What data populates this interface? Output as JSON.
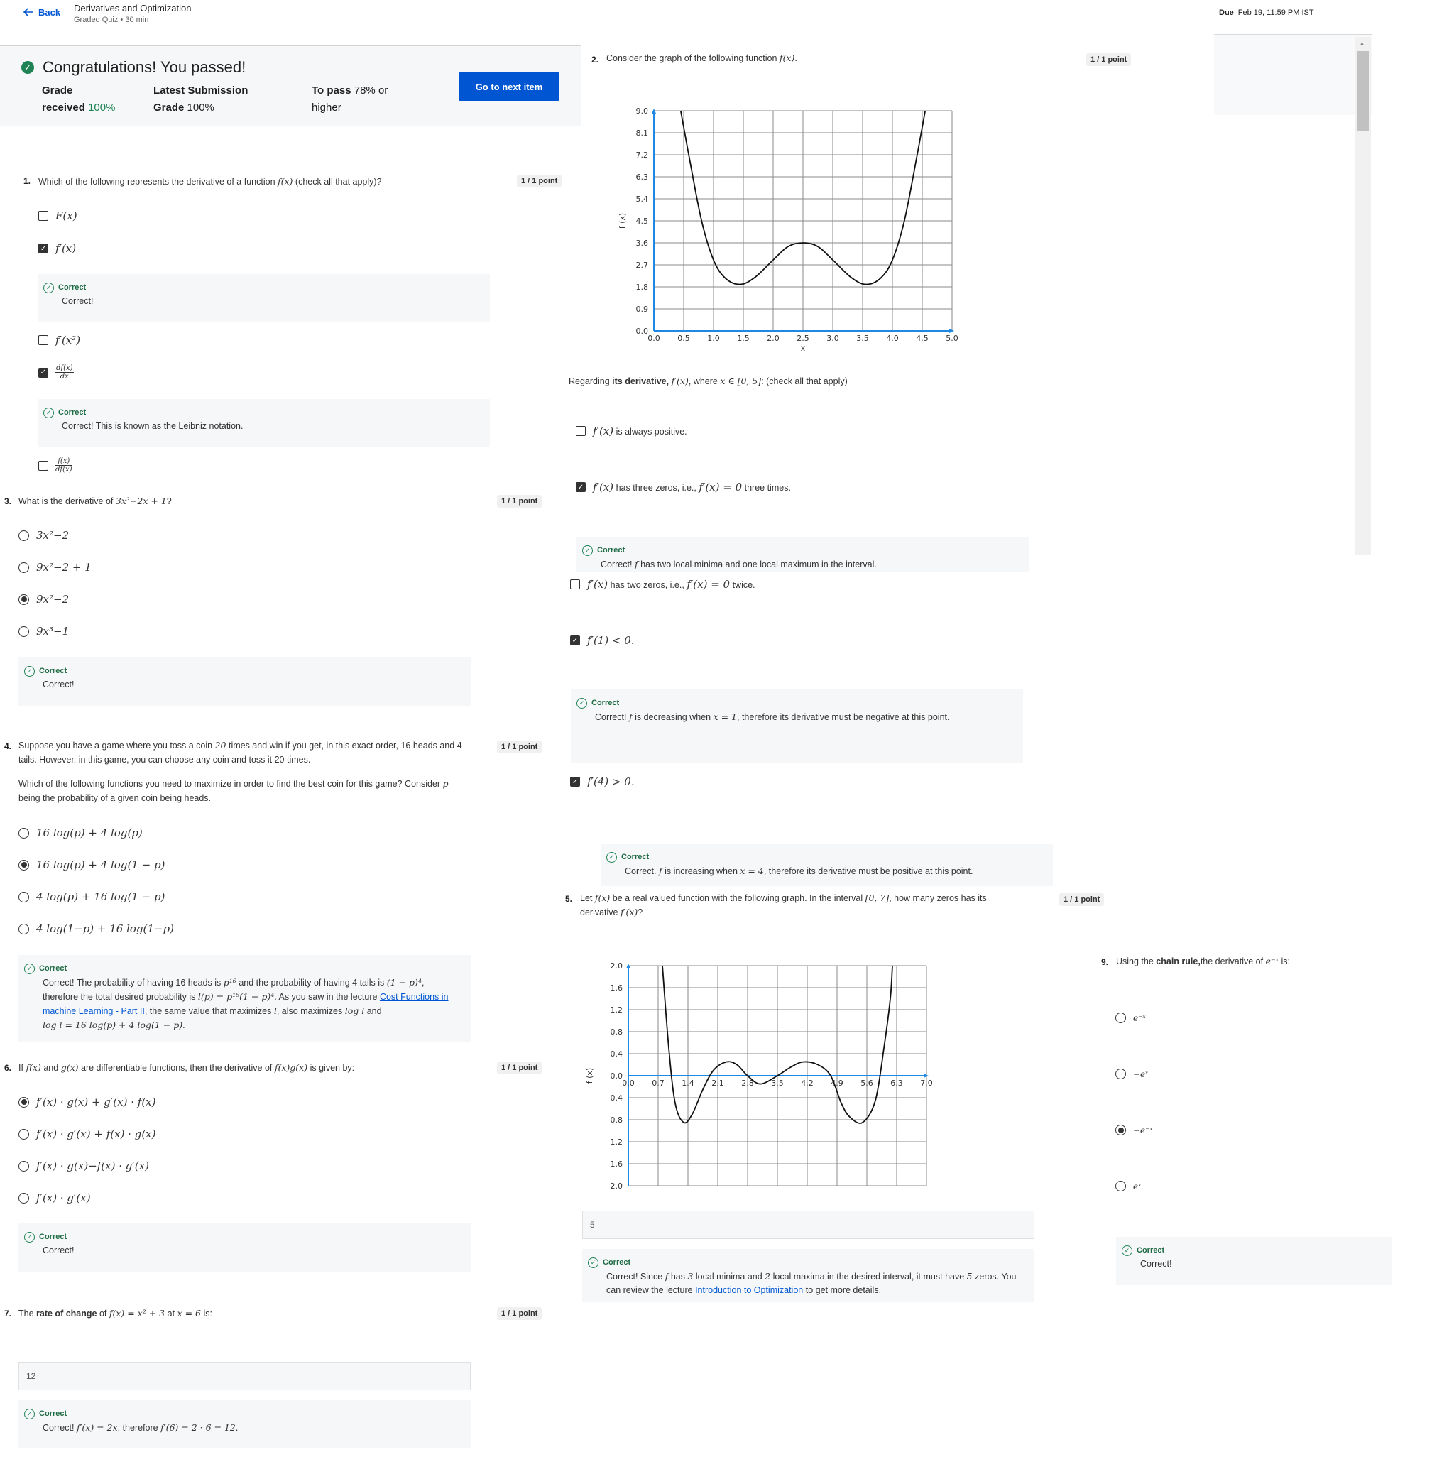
{
  "header": {
    "back": "Back",
    "title": "Derivatives and Optimization",
    "subtitle": "Graded Quiz • 30 min",
    "due_label": "Due",
    "due_value": "Feb 19, 11:59 PM IST"
  },
  "banner": {
    "title": "Congratulations! You passed!",
    "grade_label_1": "Grade",
    "grade_label_2": "received",
    "grade_value": "100%",
    "latest_label_1": "Latest Submission",
    "latest_label_2": "Grade",
    "latest_value": "100%",
    "pass_label": "To pass",
    "pass_value_1": "78% or",
    "pass_value_2": "higher",
    "next_button": "Go to next item"
  },
  "points": "1 / 1 point",
  "correct": "Correct",
  "q1": {
    "num": "1.",
    "text_pre": "Which of the following represents the derivative of a function",
    "text_post": "(check all that apply)?",
    "fb1": "Correct!",
    "fb2": "Correct! This is known as the Leibniz notation."
  },
  "q2": {
    "num": "2.",
    "text": "Consider the graph of the following function",
    "regarding_pre": "Regarding",
    "regarding_bold": "its derivative,",
    "regarding_mid": "where",
    "regarding_post": ": (check all that apply)",
    "o1": "is always positive.",
    "o2": "has three zeros, i.e.,",
    "o2b": "three times.",
    "o3": "has two zeros, i.e.,",
    "o3b": "twice.",
    "fb1_pre": "Correct!",
    "fb1_post": "has two local minima and one local maximum in the interval.",
    "fb2_pre": "Correct!",
    "fb2_mid": "is decreasing when",
    "fb2_post": ", therefore its derivative must be negative at this point.",
    "fb3_pre": "Correct.",
    "fb3_mid": "is increasing when",
    "fb3_post": ", therefore its derivative must be positive at this point."
  },
  "q3": {
    "num": "3.",
    "text": "What is the derivative of"
  },
  "q4": {
    "num": "4.",
    "text_a": "Suppose you have a game where you toss a coin",
    "text_b": "times and win if you get, in this exact order, 16 heads and 4",
    "text_c": "tails. However, in this game, you can choose any coin and toss it 20 times.",
    "text_d": "Which of the following functions you need to maximize in order to find the best coin for this game? Consider",
    "text_e": "being the probability of a given coin being heads.",
    "fb_a": "Correct! The probability of having 16 heads is",
    "fb_b": "and the probability of having 4 tails is",
    "fb_c": "therefore the total desired probability is",
    "fb_d": ". As you saw in the lecture",
    "fb_link1": "Cost Functions in",
    "fb_link2": "machine Learning - Part II",
    "fb_e": ", the same value that maximizes",
    "fb_f": ", also maximizes",
    "fb_g": "and"
  },
  "q5": {
    "num": "5.",
    "text_a": "Let",
    "text_b": "be a real valued function with the following graph. In the interval",
    "text_c": ", how many zeros has its",
    "text_d": "derivative",
    "answer": "5",
    "fb_a": "Correct! Since",
    "fb_b": "has",
    "fb_c": "local minima and",
    "fb_d": "local maxima in the desired interval, it must have",
    "fb_e": "zeros. You",
    "fb_f": "can review the lecture",
    "fb_link": "Introduction to Optimization",
    "fb_g": "to get more details."
  },
  "q6": {
    "num": "6.",
    "text_a": "If",
    "text_b": "and",
    "text_c": "are differentiable functions, then the derivative of",
    "text_d": "is given by:",
    "fb": "Correct!"
  },
  "q7": {
    "num": "7.",
    "text_pre": "The",
    "text_bold": "rate of change",
    "text_mid": "of",
    "text_post": "at",
    "text_end": "is:",
    "answer": "12",
    "fb_a": "Correct!",
    "fb_b": ", therefore"
  },
  "q9": {
    "num": "9.",
    "text_pre": "Using the",
    "text_bold": "chain rule,",
    "text_post": "the derivative of",
    "text_end": "is:",
    "fb": "Correct!"
  },
  "chart_data": [
    {
      "type": "line",
      "xlabel": "x",
      "ylabel": "f (x)",
      "x_ticks": [
        "0.0",
        "0.5",
        "1.0",
        "1.5",
        "2.0",
        "2.5",
        "3.0",
        "3.5",
        "4.0",
        "4.5",
        "5.0"
      ],
      "y_ticks": [
        "0.0",
        "0.9",
        "1.8",
        "2.7",
        "3.6",
        "4.5",
        "5.4",
        "6.3",
        "7.2",
        "8.1",
        "9.0"
      ],
      "xlim": [
        0,
        5
      ],
      "ylim": [
        0,
        9
      ],
      "grid": true,
      "x": [
        0.45,
        0.6,
        0.8,
        1.0,
        1.2,
        1.45,
        1.7,
        2.0,
        2.25,
        2.5,
        2.75,
        3.0,
        3.3,
        3.55,
        3.8,
        4.0,
        4.2,
        4.4,
        4.55
      ],
      "y": [
        9.0,
        7.0,
        4.5,
        2.9,
        2.15,
        1.9,
        2.2,
        2.9,
        3.45,
        3.6,
        3.45,
        2.9,
        2.2,
        1.9,
        2.15,
        2.9,
        4.5,
        7.0,
        9.0
      ]
    },
    {
      "type": "line",
      "ylabel": "f (x)",
      "x_ticks": [
        "0.0",
        "0.7",
        "1.4",
        "2.1",
        "2.8",
        "3.5",
        "4.2",
        "4.9",
        "5.6",
        "6.3",
        "7.0"
      ],
      "y_ticks": [
        "2.0",
        "1.6",
        "1.2",
        "0.8",
        "0.4",
        "0.0",
        "−0.4",
        "−0.8",
        "−1.2",
        "−1.6",
        "−2.0"
      ],
      "xlim": [
        0,
        7
      ],
      "ylim": [
        -2,
        2
      ],
      "grid": true,
      "x": [
        0.8,
        0.95,
        1.1,
        1.3,
        1.5,
        1.75,
        2.0,
        2.3,
        2.55,
        2.8,
        3.1,
        3.5,
        3.8,
        4.1,
        4.45,
        4.75,
        5.0,
        5.2,
        5.5,
        5.8,
        6.0,
        6.15,
        6.2
      ],
      "y": [
        2.0,
        0.5,
        -0.5,
        -0.85,
        -0.7,
        -0.25,
        0.1,
        0.25,
        0.2,
        0.0,
        -0.15,
        0.0,
        0.15,
        0.25,
        0.2,
        0.0,
        -0.5,
        -0.75,
        -0.85,
        -0.45,
        0.5,
        1.4,
        2.0
      ]
    }
  ]
}
